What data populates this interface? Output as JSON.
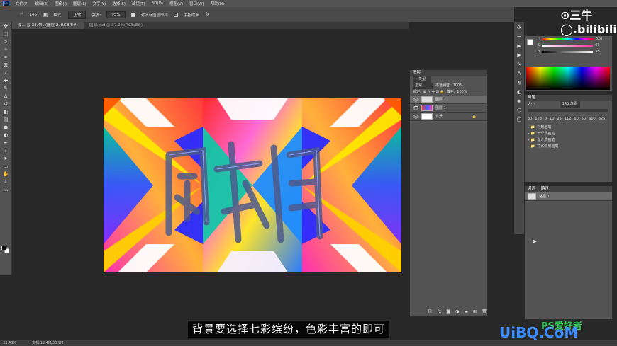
{
  "menubar": {
    "items": [
      "文件(F)",
      "编辑(E)",
      "图像(I)",
      "图层(L)",
      "文字(Y)",
      "选择(S)",
      "滤镜(T)",
      "3D(D)",
      "视图(V)",
      "窗口(W)",
      "帮助(H)"
    ]
  },
  "options": {
    "brush_size": "145",
    "mode_label": "模式:",
    "mode_value": "正常",
    "opacity_label": "强度:",
    "opacity_value": "95%",
    "sample_all": "对所有图层取样",
    "finger_paint": "手指绘画"
  },
  "tabs": [
    "瀑... @ 33.4% (图层 2, RGB/8#)",
    "国潮.psd @ 37.2%(RGB/8#)"
  ],
  "status": {
    "zoom": "33.45%",
    "doc": "文档:12.4M/33.9M"
  },
  "watermark": {
    "bili": "⊙三牛◯.bilibili"
  },
  "layers_panel": {
    "title": "图层",
    "kind": "类型",
    "blend": "正常",
    "opacity_label": "不透明度:",
    "opacity": "100%",
    "lock_label": "锁定:",
    "fill_label": "填充:",
    "fill": "100%",
    "layers": [
      {
        "name": "图层 2",
        "selected": true
      },
      {
        "name": "图层 1",
        "selected": false
      },
      {
        "name": "背景",
        "selected": false,
        "locked": true
      }
    ]
  },
  "color_panel": {
    "h_label": "H",
    "h_value": "328",
    "s_label": "S",
    "s_value": "69",
    "b_label": "B",
    "b_value": "95"
  },
  "brush_panel": {
    "title": "画笔",
    "size_label": "大小:",
    "size_value": "145 像素",
    "presets": [
      "30",
      "123",
      "8",
      "10",
      "25",
      "112",
      "60",
      "50",
      "600",
      "325"
    ],
    "groups": [
      "常规画笔",
      "干介质画笔",
      "湿介质画笔",
      "特殊效果画笔"
    ]
  },
  "paths_panel": {
    "tabs": [
      "通道",
      "路径"
    ],
    "items": [
      "路径 1"
    ]
  },
  "subtitle": "背景要选择七彩缤纷，色彩丰富的即可",
  "logos": {
    "green": "PS爱好者",
    "blue": "UiBQ.CoM"
  }
}
